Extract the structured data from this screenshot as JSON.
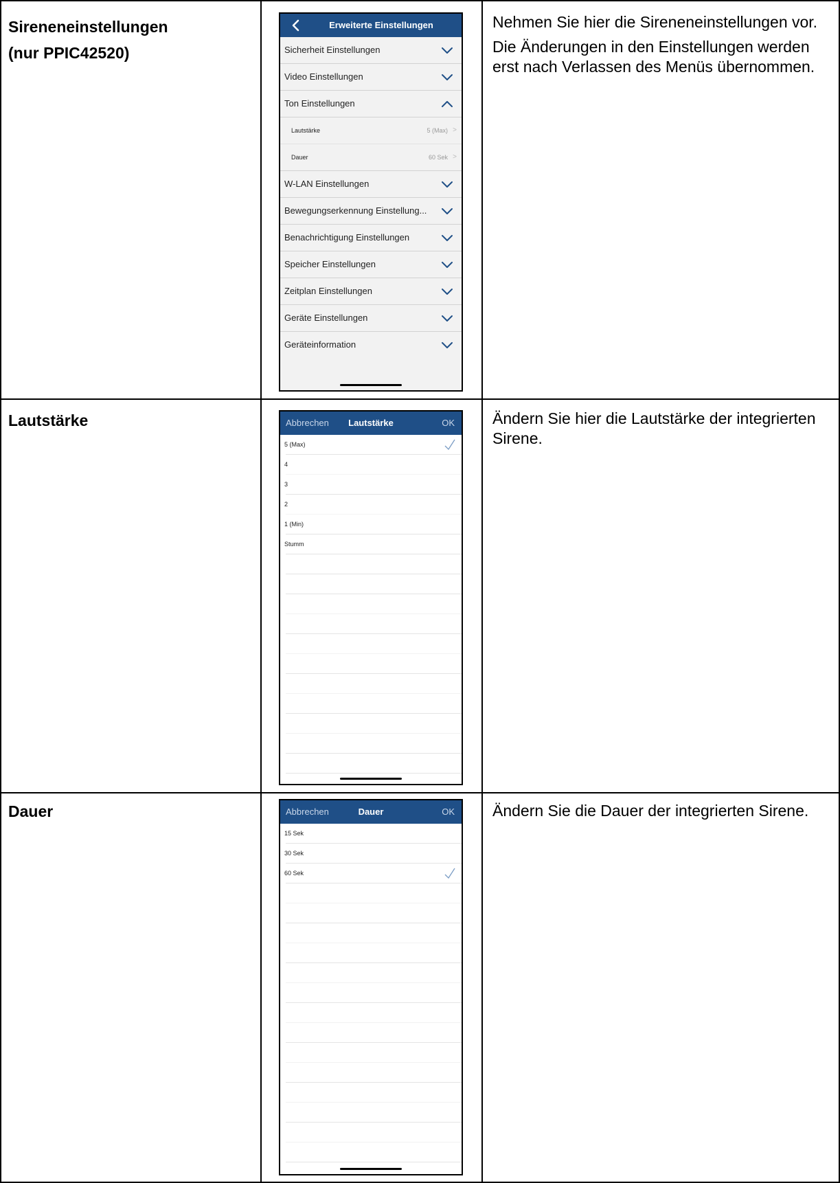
{
  "rows": [
    {
      "label_lines": [
        "Sireneneinstellungen",
        "(nur PPIC42520)"
      ],
      "description": [
        "Nehmen Sie hier die Sireneneinstellungen vor.",
        "Die Änderungen in den Einstellungen werden erst nach Verlassen des Menüs übernommen."
      ]
    },
    {
      "label_lines": [
        "Lautstärke"
      ],
      "description": [
        "Ändern Sie hier die Lautstärke der integrierten Sirene."
      ]
    },
    {
      "label_lines": [
        "Dauer"
      ],
      "description": [
        "Ändern Sie die Dauer der integrierten Sirene."
      ]
    }
  ],
  "screen_settings": {
    "title": "Erweiterte Einstellungen",
    "back_icon": "chevron-left-icon",
    "items": [
      {
        "label": "Sicherheit Einstellungen",
        "expanded": false
      },
      {
        "label": "Video Einstellungen",
        "expanded": false
      },
      {
        "label": "Ton Einstellungen",
        "expanded": true
      },
      {
        "label": "W-LAN Einstellungen",
        "expanded": false
      },
      {
        "label": "Bewegungserkennung Einstellung...",
        "expanded": false
      },
      {
        "label": "Benachrichtigung Einstellungen",
        "expanded": false
      },
      {
        "label": "Speicher Einstellungen",
        "expanded": false
      },
      {
        "label": "Zeitplan Einstellungen",
        "expanded": false
      },
      {
        "label": "Geräte Einstellungen",
        "expanded": false
      },
      {
        "label": "Geräteinformation",
        "expanded": false
      }
    ],
    "ton_subitems": [
      {
        "label": "Lautstärke",
        "value": "5 (Max)",
        "arrow": ">"
      },
      {
        "label": "Dauer",
        "value": "60 Sek",
        "arrow": ">"
      }
    ],
    "nav_color": "#1f4f87"
  },
  "screen_volume": {
    "cancel": "Abbrechen",
    "title": "Lautstärke",
    "ok": "OK",
    "options": [
      "5 (Max)",
      "4",
      "3",
      "2",
      "1 (Min)",
      "Stumm"
    ],
    "selected": "5 (Max)"
  },
  "screen_duration": {
    "cancel": "Abbrechen",
    "title": "Dauer",
    "ok": "OK",
    "options": [
      "15 Sek",
      "30 Sek",
      "60 Sek"
    ],
    "selected": "60 Sek"
  }
}
